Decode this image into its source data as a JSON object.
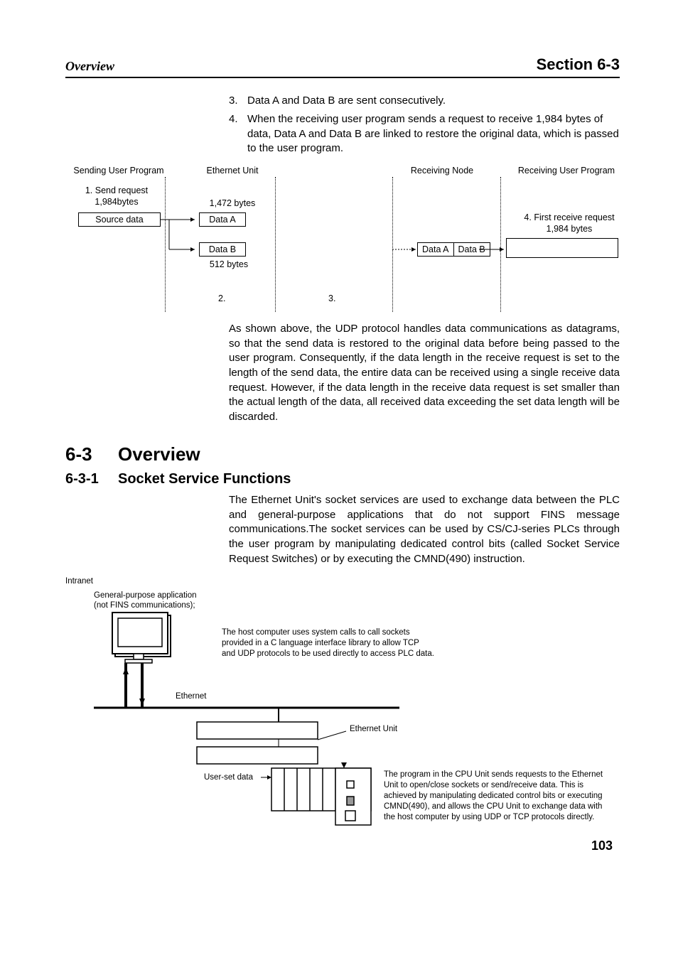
{
  "header": {
    "left": "Overview",
    "right": "Section 6-3"
  },
  "steps": [
    {
      "n": "3.",
      "t": "Data A and Data B are sent consecutively."
    },
    {
      "n": "4.",
      "t": "When the receiving user program sends a request to receive 1,984 bytes of data, Data A and Data B are linked to restore the original data, which is passed to the user program."
    }
  ],
  "d1": {
    "col1": "Sending User Program",
    "col2": "Ethernet Unit",
    "col3": "Receiving Node",
    "col4": "Receiving User Program",
    "sendReq1": "1. Send request",
    "sendReq2": "1,984bytes",
    "source": "Source data",
    "ab1": "1,472 bytes",
    "dataA": "Data A",
    "dataB": "Data B",
    "ab2": "512 bytes",
    "n2": "2.",
    "n3": "3.",
    "rDataA": "Data A",
    "rDataB": "Data B",
    "recv1": "4. First receive request",
    "recv2": "1,984 bytes"
  },
  "para1": "As shown above, the UDP protocol handles data communications as datagrams, so that the send data is restored to the original data before being passed to the user program. Consequently, if the data length in the receive request is set to the length of the send data, the entire data can be received using a single receive data request. However, if the data length in the receive data request is set smaller than the actual length of the data, all received data exceeding the set data length will be discarded.",
  "sec": {
    "num": "6-3",
    "title": "Overview"
  },
  "sub": {
    "num": "6-3-1",
    "title": "Socket Service Functions"
  },
  "para2": "The Ethernet Unit's socket services are used to exchange data between the PLC and general-purpose applications that do not support FINS message communications.The socket services can be used by CS/CJ-series PLCs through the user program by manipulating dedicated control bits (called Socket Service Request Switches) or by executing the CMND(490) instruction.",
  "d2": {
    "intranet": "Intranet",
    "gp1": "General-purpose application",
    "gp2": "(not FINS communications);",
    "host": "The host computer uses system calls to call sockets provided in a C language interface library to allow TCP and UDP protocols to be used directly to access PLC data.",
    "eth": "Ethernet",
    "eunit": "Ethernet Unit",
    "uset": "User-set data",
    "prog": "The program in the CPU Unit sends requests to the Ethernet Unit to open/close sockets or send/receive data. This is achieved by manipulating dedicated control bits or executing CMND(490), and allows the CPU Unit to exchange data with the host computer by using UDP or TCP protocols directly."
  },
  "pageNum": "103"
}
